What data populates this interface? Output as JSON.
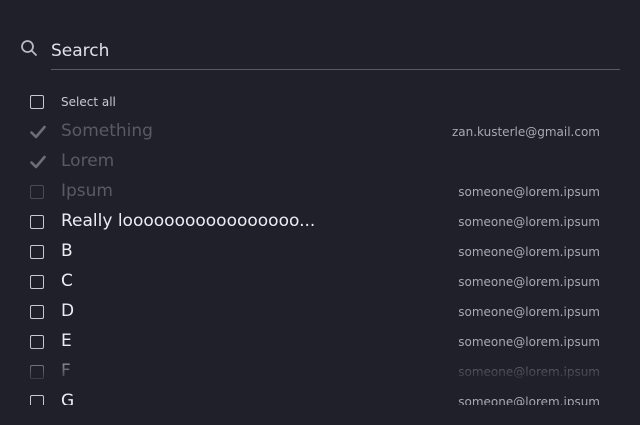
{
  "search": {
    "placeholder": "Search",
    "value": ""
  },
  "select_all_label": "Select all",
  "items": [
    {
      "name": "Something",
      "email": "zan.kusterle@gmail.com",
      "state": "checked-disabled"
    },
    {
      "name": "Lorem",
      "email": "",
      "state": "checked-disabled"
    },
    {
      "name": "Ipsum",
      "email": "someone@lorem.ipsum",
      "state": "disabled"
    },
    {
      "name": "Really looooooooooooooooo...",
      "email": "someone@lorem.ipsum",
      "state": "unchecked"
    },
    {
      "name": "B",
      "email": "someone@lorem.ipsum",
      "state": "unchecked"
    },
    {
      "name": "C",
      "email": "someone@lorem.ipsum",
      "state": "unchecked"
    },
    {
      "name": "D",
      "email": "someone@lorem.ipsum",
      "state": "unchecked"
    },
    {
      "name": "E",
      "email": "someone@lorem.ipsum",
      "state": "unchecked"
    },
    {
      "name": "F",
      "email": "someone@lorem.ipsum",
      "state": "unchecked"
    },
    {
      "name": "G",
      "email": "someone@lorem.ipsum",
      "state": "unchecked"
    }
  ],
  "colors": {
    "background": "#20202b",
    "text": "#ececf2",
    "disabled": "#5a5a66",
    "check": "#6e6e7a"
  }
}
